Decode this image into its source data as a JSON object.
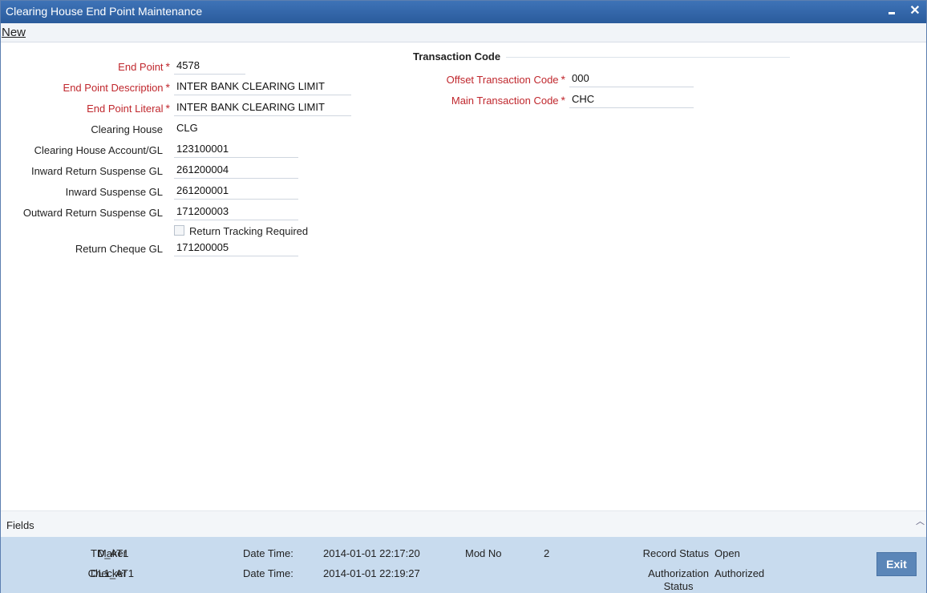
{
  "window": {
    "title": "Clearing House End Point Maintenance",
    "minimize_icon": "minimize-icon",
    "close_icon": "close-icon"
  },
  "toolbar": {
    "new_label": "New"
  },
  "form": {
    "end_point": {
      "label": "End Point",
      "value": "4578"
    },
    "end_point_description": {
      "label": "End Point Description",
      "value": "INTER BANK CLEARING LIMIT"
    },
    "end_point_literal": {
      "label": "End Point Literal",
      "value": "INTER BANK CLEARING LIMIT"
    },
    "clearing_house": {
      "label": "Clearing House",
      "value": "CLG"
    },
    "clearing_house_account": {
      "label": "Clearing House Account/GL",
      "value": "123100001"
    },
    "inward_return_suspense_gl": {
      "label": "Inward Return Suspense GL",
      "value": "261200004"
    },
    "inward_suspense_gl": {
      "label": "Inward Suspense GL",
      "value": "261200001"
    },
    "outward_return_suspense_gl": {
      "label": "Outward Return Suspense GL",
      "value": "171200003"
    },
    "return_tracking_required": {
      "label": "Return Tracking Required",
      "checked": false
    },
    "return_cheque_gl": {
      "label": "Return Cheque GL",
      "value": "171200005"
    },
    "required_marker": "*"
  },
  "transaction_code": {
    "title": "Transaction Code",
    "offset_transaction_code": {
      "label": "Offset Transaction Code",
      "value": "000"
    },
    "main_transaction_code": {
      "label": "Main Transaction Code",
      "value": "CHC"
    }
  },
  "fields_bar": {
    "label": "Fields",
    "icon": "chevron-up-icon"
  },
  "audit": {
    "maker_label": "Maker",
    "maker": "TD_AT1",
    "checker_label": "Checker",
    "checker": "DL1_AT1",
    "maker_datetime_label": "Date Time:",
    "maker_datetime": "2014-01-01 22:17:20",
    "checker_datetime_label": "Date Time:",
    "checker_datetime": "2014-01-01 22:19:27",
    "mod_no_label": "Mod No",
    "mod_no": "2",
    "record_status_label": "Record Status",
    "record_status": "Open",
    "authorization_status_label_1": "Authorization",
    "authorization_status_label_2": "Status",
    "authorization_status": "Authorized"
  },
  "exit_label": "Exit",
  "colors": {
    "title_bar": "#2f63a8",
    "required": "#c0272d",
    "audit_bg": "#c8dbee",
    "exit_button": "#5b86b8"
  }
}
